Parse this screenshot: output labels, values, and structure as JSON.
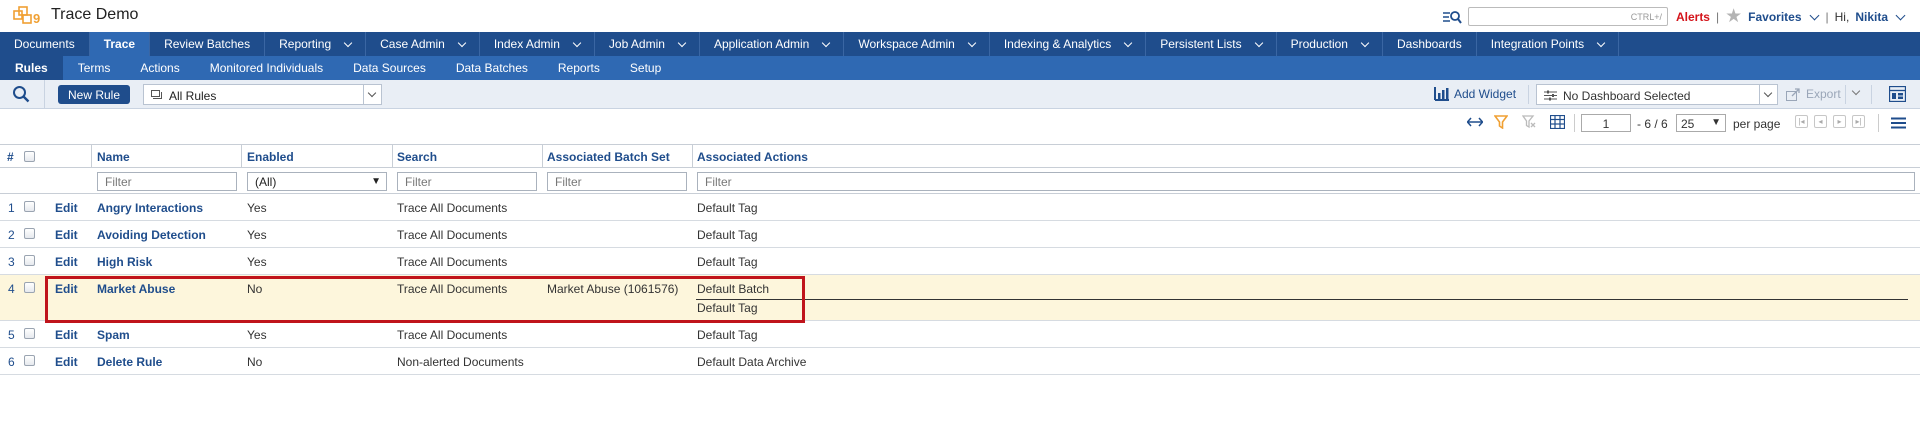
{
  "app": {
    "title": "Trace Demo"
  },
  "top_right": {
    "search_hint": "CTRL+/",
    "alerts": "Alerts",
    "separator": "|",
    "favorites": "Favorites",
    "greeting": "Hi,",
    "user": "Nikita"
  },
  "main_nav": [
    {
      "label": "Documents",
      "dropdown": false
    },
    {
      "label": "Trace",
      "dropdown": false,
      "active": true
    },
    {
      "label": "Review Batches",
      "dropdown": false
    },
    {
      "label": "Reporting",
      "dropdown": true
    },
    {
      "label": "Case Admin",
      "dropdown": true
    },
    {
      "label": "Index Admin",
      "dropdown": true
    },
    {
      "label": "Job Admin",
      "dropdown": true
    },
    {
      "label": "Application Admin",
      "dropdown": true
    },
    {
      "label": "Workspace Admin",
      "dropdown": true
    },
    {
      "label": "Indexing & Analytics",
      "dropdown": true
    },
    {
      "label": "Persistent Lists",
      "dropdown": true
    },
    {
      "label": "Production",
      "dropdown": true
    },
    {
      "label": "Dashboards",
      "dropdown": false
    },
    {
      "label": "Integration Points",
      "dropdown": true
    }
  ],
  "sub_nav": [
    {
      "label": "Rules",
      "active": true
    },
    {
      "label": "Terms"
    },
    {
      "label": "Actions"
    },
    {
      "label": "Monitored Individuals"
    },
    {
      "label": "Data Sources"
    },
    {
      "label": "Data Batches"
    },
    {
      "label": "Reports"
    },
    {
      "label": "Setup"
    }
  ],
  "toolbar": {
    "new_rule": "New Rule",
    "view": "All Rules",
    "add_widget": "Add Widget",
    "dashboard": "No Dashboard Selected",
    "export": "Export"
  },
  "pager": {
    "page": "1",
    "total": "- 6 / 6",
    "per_page": "25",
    "per_page_label": "per page"
  },
  "grid": {
    "headers": {
      "num": "#",
      "name": "Name",
      "enabled": "Enabled",
      "search": "Search",
      "batch_set": "Associated Batch Set",
      "actions": "Associated Actions"
    },
    "filter_placeholder": "Filter",
    "enabled_filter": "(All)",
    "edit_label": "Edit",
    "rows": [
      {
        "num": "1",
        "name": "Angry Interactions",
        "enabled": "Yes",
        "search": "Trace All Documents",
        "batch_set": "",
        "actions": [
          "Default Tag"
        ]
      },
      {
        "num": "2",
        "name": "Avoiding Detection",
        "enabled": "Yes",
        "search": "Trace All Documents",
        "batch_set": "",
        "actions": [
          "Default Tag"
        ]
      },
      {
        "num": "3",
        "name": "High Risk",
        "enabled": "Yes",
        "search": "Trace All Documents",
        "batch_set": "",
        "actions": [
          "Default Tag"
        ]
      },
      {
        "num": "4",
        "name": "Market Abuse",
        "enabled": "No",
        "search": "Trace All Documents",
        "batch_set": "Market Abuse (1061576)",
        "actions": [
          "Default Batch",
          "Default Tag"
        ],
        "highlighted": true
      },
      {
        "num": "5",
        "name": "Spam",
        "enabled": "Yes",
        "search": "Trace All Documents",
        "batch_set": "",
        "actions": [
          "Default Tag"
        ]
      },
      {
        "num": "6",
        "name": "Delete Rule",
        "enabled": "No",
        "search": "Non-alerted Documents",
        "batch_set": "",
        "actions": [
          "Default Data Archive"
        ]
      }
    ]
  },
  "colors": {
    "nav_dark": "#1f4d8c",
    "nav_light": "#2f69b3",
    "alert_red": "#d4141b",
    "highlight_row": "#fdf6dc",
    "annotation_red": "#c0141b"
  }
}
